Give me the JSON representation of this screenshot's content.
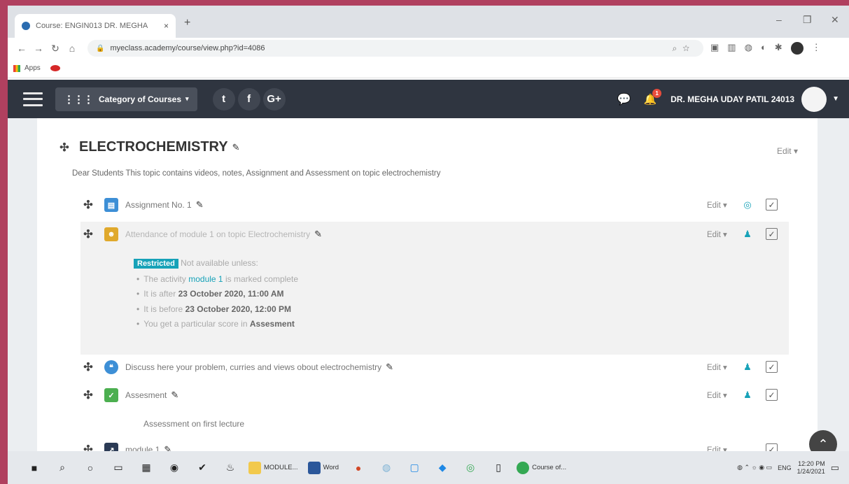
{
  "browser": {
    "tab_title": "Course: ENGIN013 DR. MEGHA",
    "tab_close": "×",
    "new_tab": "+",
    "url": "myeclass.academy/course/view.php?id=4086",
    "bookmark_apps": "Apps",
    "window_controls": [
      "–",
      "❐",
      "✕"
    ]
  },
  "navbar": {
    "category_label": "Category of Courses",
    "social": [
      "t",
      "f",
      "G+"
    ],
    "notification_count": "1",
    "user_name": "DR. MEGHA UDAY PATIL 24013"
  },
  "section": {
    "title": "ELECTROCHEMISTRY",
    "edit": "Edit",
    "summary": "Dear Students This topic contains videos, notes, Assignment and Assessment on topic electrochemistry"
  },
  "activities": [
    {
      "name": "Assignment No. 1",
      "edit": "Edit",
      "icon": "assignment-icon",
      "color": "#3d8fd6"
    },
    {
      "name": "Attendance of module 1 on topic Electrochemistry",
      "edit": "Edit",
      "icon": "attendance-icon",
      "color": "#e0a92c"
    },
    {
      "name": "Discuss here your problem, curries and views obout electrochemistry",
      "edit": "Edit",
      "icon": "forum-icon",
      "color": "#3d8fd6"
    },
    {
      "name": "Assesment",
      "edit": "Edit",
      "icon": "quiz-icon",
      "color": "#4caf50"
    },
    {
      "name": "module 1",
      "edit": "Edit",
      "icon": "url-icon",
      "color": "#2b3b55"
    }
  ],
  "restriction": {
    "badge": "Restricted",
    "intro": "Not available unless:",
    "item1_pre": "The activity",
    "item1_link": "module 1",
    "item1_post": "is marked complete",
    "item2_pre": "It is after",
    "item2_bold": "23 October 2020, 11:00 AM",
    "item3_pre": "It is before",
    "item3_bold": "23 October 2020, 12:00 PM",
    "item4_pre": "You get a particular score in",
    "item4_bold": "Assesment"
  },
  "assesment_description": "Assessment on first lecture",
  "taskbar": {
    "app1": "MODULE...",
    "app2": "Word",
    "app3": "Course of...",
    "lang": "ENG",
    "time": "12:20 PM",
    "date": "1/24/2021"
  }
}
